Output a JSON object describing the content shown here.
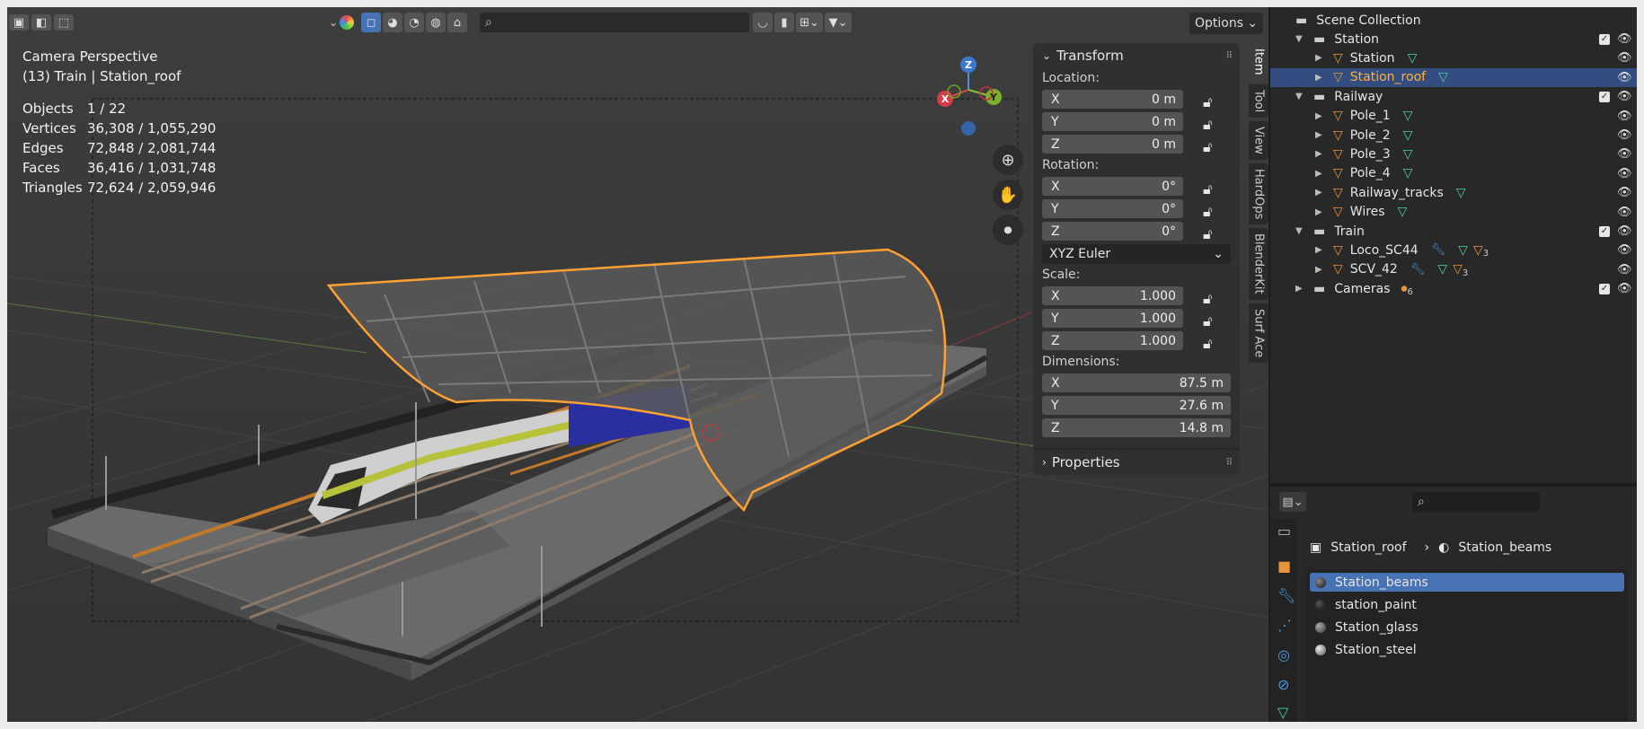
{
  "header": {
    "options_label": "Options",
    "search_placeholder": ""
  },
  "viewport": {
    "view_name": "Camera Perspective",
    "context": "(13) Train | Station_roof",
    "stats": [
      {
        "label": "Objects",
        "value": "1 / 22"
      },
      {
        "label": "Vertices",
        "value": "36,308 / 1,055,290"
      },
      {
        "label": "Edges",
        "value": "72,848 / 2,081,744"
      },
      {
        "label": "Faces",
        "value": "36,416 / 1,031,748"
      },
      {
        "label": "Triangles",
        "value": "72,624 / 2,059,946"
      }
    ],
    "gizmo": {
      "x": "X",
      "y": "Y",
      "z": "Z"
    }
  },
  "npanel": {
    "transform_title": "Transform",
    "location_label": "Location:",
    "location": [
      {
        "axis": "X",
        "value": "0 m"
      },
      {
        "axis": "Y",
        "value": "0 m"
      },
      {
        "axis": "Z",
        "value": "0 m"
      }
    ],
    "rotation_label": "Rotation:",
    "rotation": [
      {
        "axis": "X",
        "value": "0°"
      },
      {
        "axis": "Y",
        "value": "0°"
      },
      {
        "axis": "Z",
        "value": "0°"
      }
    ],
    "rotation_mode": "XYZ Euler",
    "scale_label": "Scale:",
    "scale": [
      {
        "axis": "X",
        "value": "1.000"
      },
      {
        "axis": "Y",
        "value": "1.000"
      },
      {
        "axis": "Z",
        "value": "1.000"
      }
    ],
    "dimensions_label": "Dimensions:",
    "dimensions": [
      {
        "axis": "X",
        "value": "87.5 m"
      },
      {
        "axis": "Y",
        "value": "27.6 m"
      },
      {
        "axis": "Z",
        "value": "14.8 m"
      }
    ],
    "properties_title": "Properties"
  },
  "sidetabs": [
    "Item",
    "Tool",
    "View",
    "HardOps",
    "BlenderKit",
    "Surf Ace"
  ],
  "outliner": {
    "root": "Scene Collection",
    "rows": [
      {
        "name": "Station",
        "kind": "collection",
        "indent": 0
      },
      {
        "name": "Station",
        "kind": "object",
        "indent": 1
      },
      {
        "name": "Station_roof",
        "kind": "object",
        "indent": 1,
        "selected": true
      },
      {
        "name": "Railway",
        "kind": "collection",
        "indent": 0
      },
      {
        "name": "Pole_1",
        "kind": "object",
        "indent": 1
      },
      {
        "name": "Pole_2",
        "kind": "object",
        "indent": 1
      },
      {
        "name": "Pole_3",
        "kind": "object",
        "indent": 1
      },
      {
        "name": "Pole_4",
        "kind": "object",
        "indent": 1
      },
      {
        "name": "Railway_tracks",
        "kind": "object",
        "indent": 1
      },
      {
        "name": "Wires",
        "kind": "object",
        "indent": 1
      },
      {
        "name": "Train",
        "kind": "collection",
        "indent": 0
      },
      {
        "name": "Loco_SC44",
        "kind": "object",
        "indent": 1,
        "count": "3"
      },
      {
        "name": "SCV_42",
        "kind": "object",
        "indent": 1,
        "count": "3"
      },
      {
        "name": "Cameras",
        "kind": "collection",
        "indent": 0,
        "count": "6"
      }
    ]
  },
  "properties": {
    "search_placeholder": "",
    "breadcrumb_object": "Station_roof",
    "breadcrumb_material": "Station_beams",
    "materials": [
      {
        "name": "Station_beams",
        "selected": true
      },
      {
        "name": "station_paint"
      },
      {
        "name": "Station_glass"
      },
      {
        "name": "Station_steel"
      }
    ]
  },
  "colors": {
    "selection_orange": "#ffa033",
    "active_blue": "#4772b3",
    "mesh_green": "#4bd1a0",
    "object_orange": "#e8943a"
  }
}
